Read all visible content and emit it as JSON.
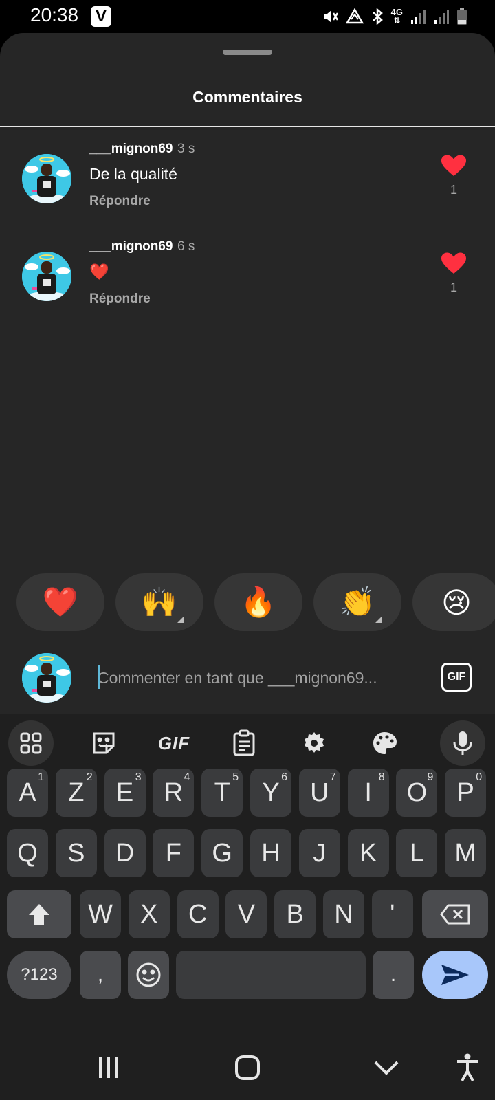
{
  "status_bar": {
    "time": "20:38",
    "app_badge": "V",
    "network": "4G"
  },
  "sheet": {
    "title": "Commentaires"
  },
  "comments": [
    {
      "user": "___mignon69",
      "time": "3 s",
      "text": "De la qualité",
      "reply": "Répondre",
      "likes": "1"
    },
    {
      "user": "___mignon69",
      "time": "6 s",
      "text": "❤️",
      "reply": "Répondre",
      "likes": "1"
    }
  ],
  "reactions": [
    "❤️",
    "🙌",
    "🔥",
    "👏",
    "😢"
  ],
  "comment_input": {
    "placeholder": "Commenter en tant que ___mignon69..."
  },
  "gif_button": "GIF",
  "keyboard": {
    "toolbar_gif": "GIF",
    "row1": [
      {
        "k": "A",
        "n": "1"
      },
      {
        "k": "Z",
        "n": "2"
      },
      {
        "k": "E",
        "n": "3"
      },
      {
        "k": "R",
        "n": "4"
      },
      {
        "k": "T",
        "n": "5"
      },
      {
        "k": "Y",
        "n": "6"
      },
      {
        "k": "U",
        "n": "7"
      },
      {
        "k": "I",
        "n": "8"
      },
      {
        "k": "O",
        "n": "9"
      },
      {
        "k": "P",
        "n": "0"
      }
    ],
    "row2": [
      "Q",
      "S",
      "D",
      "F",
      "G",
      "H",
      "J",
      "K",
      "L",
      "M"
    ],
    "row3": [
      "W",
      "X",
      "C",
      "V",
      "B",
      "N",
      "'"
    ],
    "symbols_key": "?123",
    "comma_key": ",",
    "period_key": "."
  },
  "colors": {
    "like": "#ff3040",
    "sheet_bg": "#262626",
    "send_key": "#a8c7fa"
  }
}
